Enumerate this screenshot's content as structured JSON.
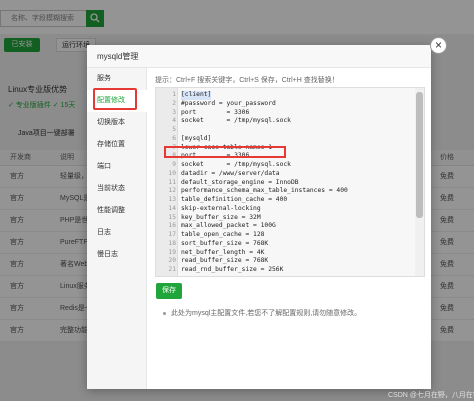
{
  "background": {
    "search_placeholder": "名称、字段模糊搜索",
    "tabs": {
      "installed": "已安装",
      "runtime": "运行环境"
    },
    "promo": {
      "title": "Linux专业版优势",
      "items": "✓ 专业版插件   ✓ 15天"
    },
    "java_deploy": "Java项目一键部署",
    "table": {
      "headers": [
        "开发商",
        "说明",
        "价格"
      ],
      "rows": [
        [
          "官方",
          "轻量级，占",
          "免费"
        ],
        [
          "官方",
          "MySQL是一",
          "免费"
        ],
        [
          "官方",
          "PHP是世界",
          "免费"
        ],
        [
          "官方",
          "PureFTPd",
          "免费"
        ],
        [
          "官方",
          "著名Web",
          "免费"
        ],
        [
          "官方",
          "Linux服务",
          "免费"
        ],
        [
          "官方",
          "Redis是一",
          "免费"
        ],
        [
          "官方",
          "完整功能",
          "免费"
        ]
      ]
    }
  },
  "modal": {
    "title": "mysqld管理",
    "close_label": "×",
    "sidebar": [
      "服务",
      "配置修改",
      "切换版本",
      "存储位置",
      "端口",
      "当前状态",
      "性能调整",
      "日志",
      "慢日志"
    ],
    "active_sidebar_index": 1,
    "hint": "提示：Ctrl+F 搜索关键字，Ctrl+S 保存，Ctrl+H 查找替换！",
    "editor_lines": [
      {
        "n": "1",
        "text": "[client]"
      },
      {
        "n": "2",
        "text": "#password = your_password"
      },
      {
        "n": "3",
        "text": "port        = 3306"
      },
      {
        "n": "4",
        "text": "socket      = /tmp/mysql.sock"
      },
      {
        "n": "5",
        "text": ""
      },
      {
        "n": "6",
        "text": "[mysqld]"
      },
      {
        "n": "7",
        "text": "lower-case-table-names=1"
      },
      {
        "n": "8",
        "text": "port        = 3306"
      },
      {
        "n": "9",
        "text": "socket      = /tmp/mysql.sock"
      },
      {
        "n": "10",
        "text": "datadir = /www/server/data"
      },
      {
        "n": "11",
        "text": "default_storage_engine = InnoDB"
      },
      {
        "n": "12",
        "text": "performance_schema_max_table_instances = 400"
      },
      {
        "n": "13",
        "text": "table_definition_cache = 400"
      },
      {
        "n": "14",
        "text": "skip-external-locking"
      },
      {
        "n": "15",
        "text": "key_buffer_size = 32M"
      },
      {
        "n": "16",
        "text": "max_allowed_packet = 100G"
      },
      {
        "n": "17",
        "text": "table_open_cache = 128"
      },
      {
        "n": "18",
        "text": "sort_buffer_size = 768K"
      },
      {
        "n": "19",
        "text": "net_buffer_length = 4K"
      },
      {
        "n": "20",
        "text": "read_buffer_size = 768K"
      },
      {
        "n": "21",
        "text": "read_rnd_buffer_size = 256K"
      }
    ],
    "save_label": "保存",
    "note": "此处为mysql主配置文件,若您不了解配置规则,请勿随意修改。"
  },
  "watermark": "CSDN @七月在野，八月在宇"
}
